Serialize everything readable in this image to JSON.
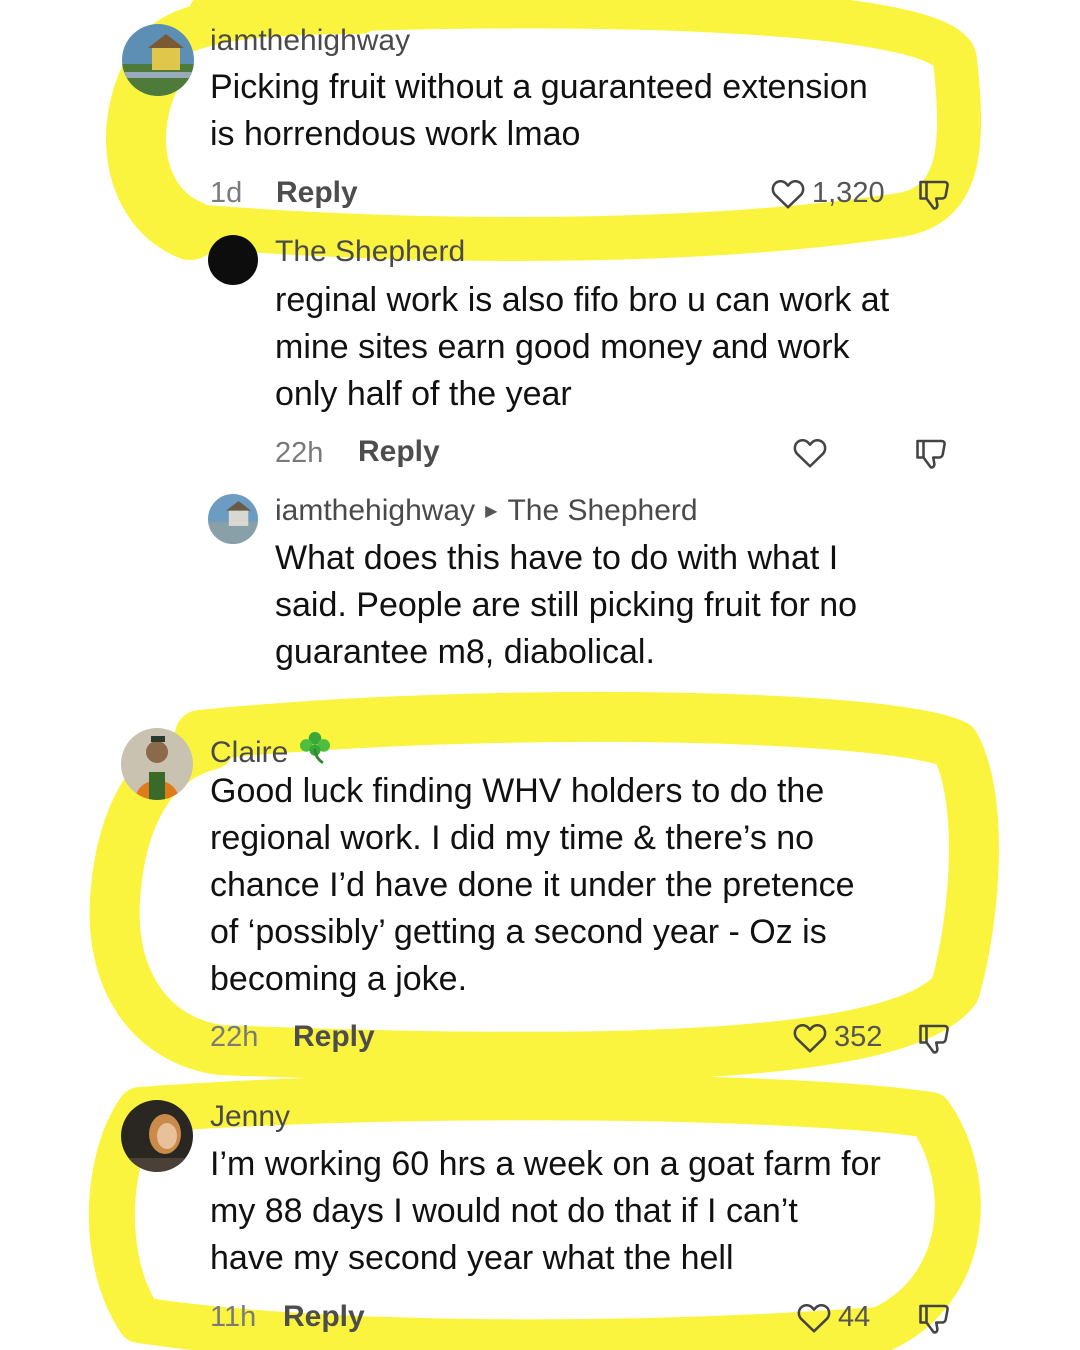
{
  "comments": [
    {
      "username": "iamthehighway",
      "lines": [
        "Picking fruit without a guaranteed extension",
        "is horrendous work lmao"
      ],
      "age": "1d",
      "reply_label": "Reply",
      "likes": "1,320",
      "replies": [
        {
          "username": "The Shepherd",
          "lines": [
            "reginal work is also fifo bro u can work at",
            "mine sites earn good money and work",
            "only half of the year"
          ],
          "age": "22h",
          "reply_label": "Reply"
        },
        {
          "username": "iamthehighway",
          "reply_to": "The Shepherd",
          "lines": [
            "What does this have to do with what I",
            "said. People are still picking fruit for no",
            "guarantee m8, diabolical."
          ]
        }
      ]
    },
    {
      "username": "Claire",
      "badge_icon": "shamrock-icon",
      "lines": [
        "Good luck finding WHV holders to do the",
        "regional work. I did my time & there’s no",
        "chance I’d have done it under the pretence",
        "of ‘possibly’ getting a second year - Oz is",
        "becoming a joke."
      ],
      "age": "22h",
      "reply_label": "Reply",
      "likes": "352"
    },
    {
      "username": "Jenny",
      "lines": [
        "I’m working 60 hrs a week on a goat farm for",
        "my 88 days I would not do that if I can’t",
        "have my second year what the hell"
      ],
      "age": "11h",
      "reply_label": "Reply",
      "likes": "44"
    }
  ],
  "colors": {
    "highlight": "#fbf43f",
    "text": "#111111",
    "username": "#4a4a4a",
    "meta": "#7a7a7a"
  }
}
